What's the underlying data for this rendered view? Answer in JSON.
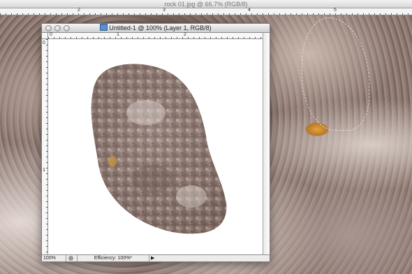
{
  "background_window": {
    "title": "rock 01.jpg @ 66.7% (RGB/8)",
    "ruler_numbers": [
      "2",
      "3",
      "4",
      "5"
    ]
  },
  "document_window": {
    "title": "Untitled-1 @ 100% (Layer 1, RGB/8)",
    "ruler_h_numbers": [
      "0",
      "1",
      "2"
    ],
    "ruler_v_numbers": [
      "0",
      "1"
    ],
    "status": {
      "zoom": "100%",
      "info": "Efficiency: 100%*",
      "menu_arrow": "▶"
    }
  },
  "colors": {
    "rock_base": "#8e7a73",
    "orange_lichen": "#e6a23c",
    "canvas_white": "#ffffff"
  },
  "icons": [
    "close-icon",
    "minimize-icon",
    "zoom-icon",
    "document-icon",
    "status-icon",
    "arrow-right-icon"
  ]
}
